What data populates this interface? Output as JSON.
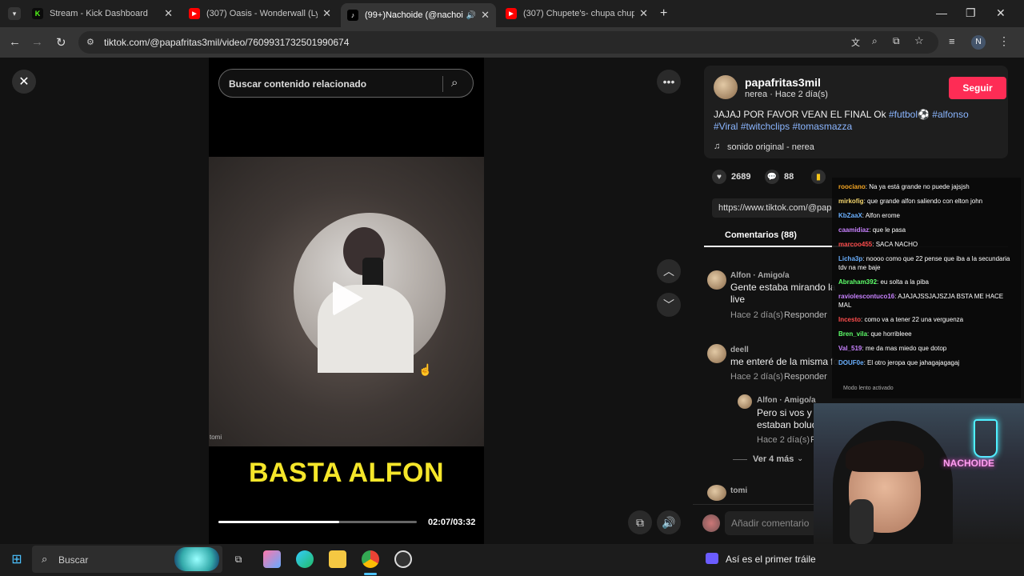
{
  "browser": {
    "tabs": [
      {
        "title": "Stream - Kick Dashboard",
        "favicon": "kick-icon",
        "color": "#53fc18"
      },
      {
        "title": "(307) Oasis - Wonderwall (Lyric",
        "favicon": "youtube-icon",
        "color": "#ff0000"
      },
      {
        "title": "(99+)Nachoide (@nachoide",
        "favicon": "tiktok-icon",
        "color": "#ffffff",
        "active": true
      },
      {
        "title": "(307) Chupete's- chupa chupa c",
        "favicon": "youtube-icon",
        "color": "#ff0000"
      }
    ],
    "url": "tiktok.com/@papafritas3mil/video/7609931732501990674",
    "profile_initial": "N"
  },
  "video": {
    "search_placeholder": "Buscar contenido relacionado",
    "caption": "BASTA ALFON",
    "timecode": "02:07/03:32",
    "progress": 0.61,
    "watermark": "tomi"
  },
  "post": {
    "username": "papafritas3mil",
    "subline": "nerea · Hace 2 día(s)",
    "follow_label": "Seguir",
    "description": "JAJAJ POR FAVOR VEAN EL FINAL Ok",
    "tags_line1": [
      "#futbol⚽",
      "#alfonso"
    ],
    "tags_line2": [
      "#Viral",
      "#twitchclips",
      "#tomasmazza"
    ],
    "sound": "sonido original - nerea",
    "likes": "2689",
    "comments_count": "88",
    "link": "https://www.tiktok.com/@pap",
    "comments_tab": "Comentarios (88)"
  },
  "comments": [
    {
      "name": "Alfon · Amigo/a",
      "text_1": "Gente estaba mirando la",
      "text_2": "live",
      "time": "Hace 2 día(s)",
      "reply": "Responder"
    },
    {
      "name": "deell",
      "text_1": "me enteré de la misma fo",
      "time": "Hace 2 día(s)",
      "reply": "Responder"
    },
    {
      "name": "Alfon · Amigo/a",
      "text_1": "Pero si vos y a",
      "text_2": "estaban bolud",
      "time": "Hace 2 día(s)",
      "reply": "R"
    },
    {
      "name": "tomi"
    }
  ],
  "more_replies": "Ver 4 más",
  "add_comment_placeholder": "Añadir comentario",
  "chat": {
    "messages": [
      {
        "user": "roociano",
        "text": ": Na ya está grande no puede jajsjsh",
        "color": "#f5a623"
      },
      {
        "user": "mirkofig",
        "text": ": que grande alfon saliendo con elton john",
        "color": "#f5d76e"
      },
      {
        "user": "KbZaaX",
        "text": ": Alfon erome",
        "color": "#6ab0ff"
      },
      {
        "user": "caamidiaz",
        "text": ": que le pasa",
        "color": "#c882ff"
      },
      {
        "user": "marcoo455",
        "text": ": SACA NACHO",
        "color": "#ff4d4d"
      },
      {
        "user": "Licha3p",
        "text": ": noooo como que 22 pense que iba a la secundaria tdv na me baje",
        "color": "#6ab0ff"
      },
      {
        "user": "Abraham392",
        "text": ": eu solta a la piba",
        "color": "#5eff6a"
      },
      {
        "user": "raviolescontuco16",
        "text": ": AJAJAJSSJAJSZJA BSTA ME HACE MAL",
        "color": "#c882ff"
      },
      {
        "user": "Incesto",
        "text": ": como va a tener 22 una verguenza",
        "color": "#ff4d4d"
      },
      {
        "user": "Bren_vila",
        "text": ": que horribleee",
        "color": "#5eff6a"
      },
      {
        "user": "Val_519",
        "text": ": me da mas miedo que dotop",
        "color": "#c882ff"
      },
      {
        "user": "DOUF0e",
        "text": ": El otro jeropa que jahagajagagaj",
        "color": "#6ab0ff"
      }
    ],
    "footer": "Modo lento activado"
  },
  "webcam": {
    "sign": "NACHOIDE"
  },
  "taskbar": {
    "search_label": "Buscar",
    "news": "Así es el primer tráile"
  }
}
